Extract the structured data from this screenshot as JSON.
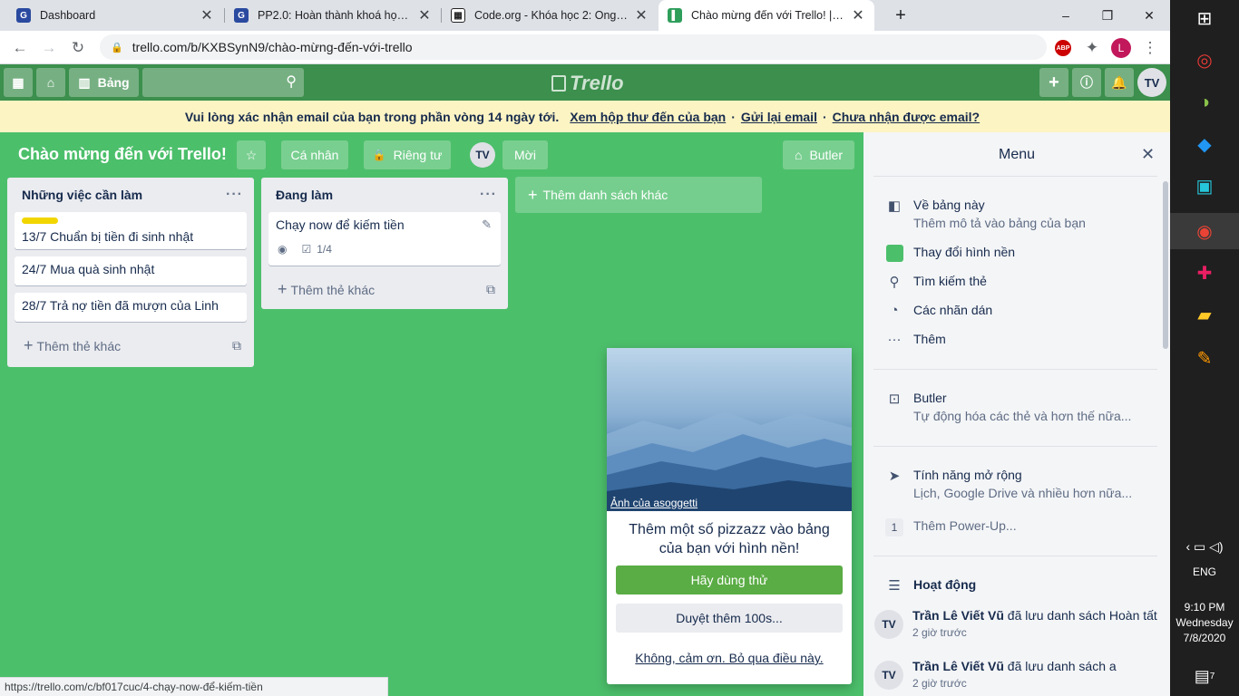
{
  "browser": {
    "tabs": [
      {
        "title": "Dashboard",
        "favicon_color": "#2a4aa0",
        "favicon_letter": "G",
        "active": false
      },
      {
        "title": "PP2.0: Hoàn thành khoá học 2 trê",
        "favicon_color": "#2a4aa0",
        "favicon_letter": "G",
        "active": false
      },
      {
        "title": "Code.org - Khóa học 2: Ong: vòn",
        "favicon_color": "#222",
        "favicon_letter": "▦",
        "active": false
      },
      {
        "title": "Chào mừng đến với Trello! | Trello",
        "favicon_color": "#2e9e5b",
        "favicon_letter": "▌",
        "active": true
      }
    ],
    "new_tab": "+",
    "window_controls": {
      "minimize": "–",
      "maximize": "❐",
      "close": "✕"
    },
    "url": "trello.com/b/KXBSynN9/chào-mừng-đến-với-trello",
    "profile_letter": "L",
    "abp_label": "ABP"
  },
  "trello_header": {
    "boards_label": "Bảng",
    "logo_text": "Trello",
    "avatar": "TV"
  },
  "banner": {
    "text": "Vui lòng xác nhận email của bạn trong phần vòng 14 ngày tới.",
    "link1": "Xem hộp thư đến của bạn",
    "sep1": "·",
    "link2": "Gửi lại email",
    "sep2": "·",
    "link3": "Chưa nhận được email?"
  },
  "board": {
    "title": "Chào mừng đến với Trello!",
    "visibility_team": "Cá nhân",
    "visibility_private": "Riêng tư",
    "member": "TV",
    "invite": "Mời",
    "butler": "Butler",
    "lists": [
      {
        "name": "Những việc cần làm",
        "cards": [
          "13/7 Chuẩn bị tiền đi sinh nhật",
          "24/7 Mua quà sinh nhật",
          "28/7 Trả nợ tiền đã mượn của Linh"
        ],
        "add_card": "Thêm thẻ khác"
      },
      {
        "name": "Đang làm",
        "cards": [
          "Chạy now để kiếm tiền"
        ],
        "checklist": "1/4",
        "add_card": "Thêm thẻ khác"
      }
    ],
    "add_list": "Thêm danh sách khác"
  },
  "popup": {
    "credit": "Ảnh của asoggetti",
    "text": "Thêm một số pizzazz vào bảng của bạn với hình nền!",
    "primary": "Hãy dùng thử",
    "secondary": "Duyệt thêm 100s...",
    "dismiss": "Không, cảm ơn. Bỏ qua điều này."
  },
  "menu": {
    "title": "Menu",
    "about_title": "Về bảng này",
    "about_sub": "Thêm mô tả vào bảng của bạn",
    "change_bg": "Thay đổi hình nền",
    "bg_color": "#4cbf6b",
    "search": "Tìm kiếm thẻ",
    "stickers": "Các nhãn dán",
    "more": "Thêm",
    "butler_title": "Butler",
    "butler_sub": "Tự động hóa các thẻ và hơn thế nữa...",
    "powerups_title": "Tính năng mở rộng",
    "powerups_sub": "Lịch, Google Drive và nhiều hơn nữa...",
    "powerup_count": "1",
    "add_powerup": "Thêm Power-Up...",
    "activity_title": "Hoạt động",
    "activities": [
      {
        "avatar": "TV",
        "user": "Trần Lê Viết Vũ",
        "action": "đã lưu danh sách Hoàn tất",
        "time": "2 giờ trước"
      },
      {
        "avatar": "TV",
        "user": "Trần Lê Viết Vũ",
        "action": "đã lưu danh sách a",
        "time": "2 giờ trước"
      }
    ]
  },
  "status_url": "https://trello.com/c/bf017cuc/4-chạy-now-để-kiếm-tiền",
  "taskbar": {
    "language": "ENG",
    "time": "9:10 PM",
    "day": "Wednesday",
    "date": "7/8/2020",
    "notifications": "7"
  }
}
